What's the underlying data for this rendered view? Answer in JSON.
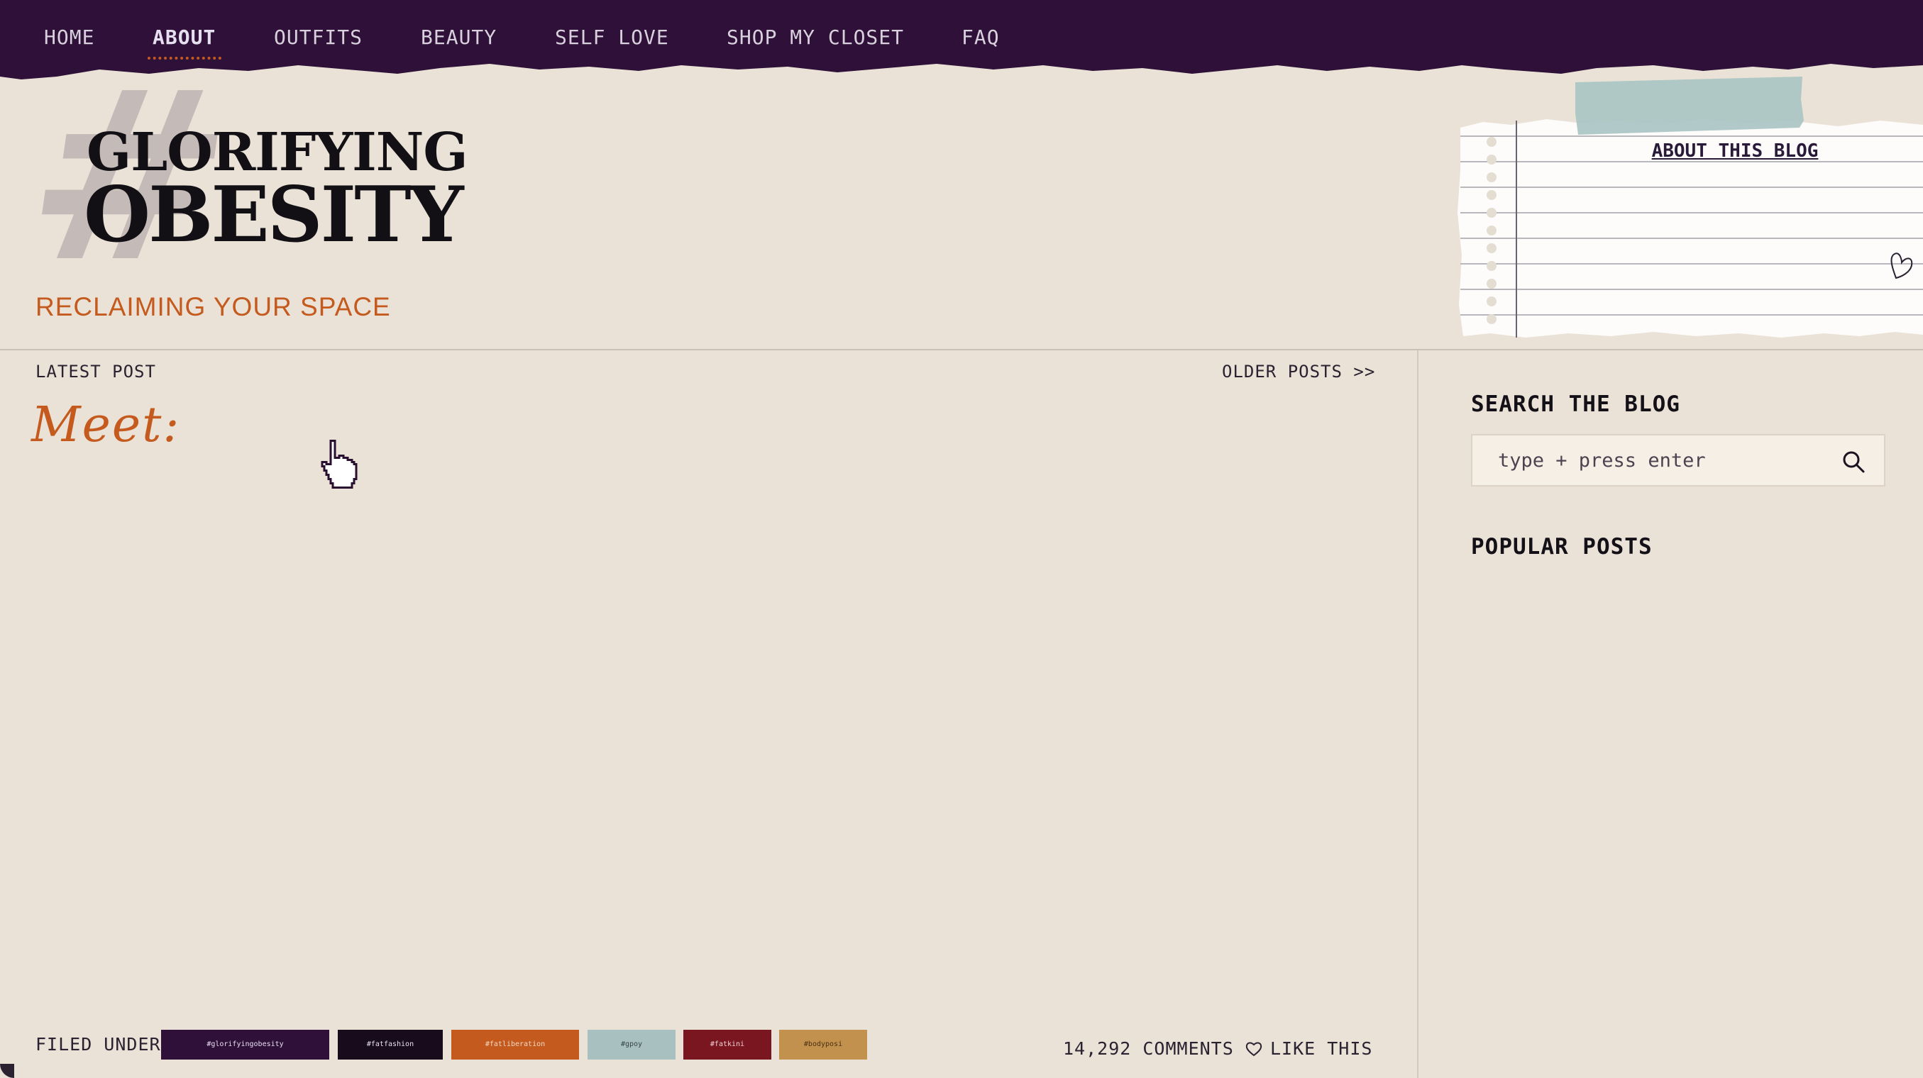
{
  "nav": {
    "items": [
      {
        "label": "HOME"
      },
      {
        "label": "ABOUT"
      },
      {
        "label": "OUTFITS"
      },
      {
        "label": "BEAUTY"
      },
      {
        "label": "SELF LOVE"
      },
      {
        "label": "SHOP MY CLOSET"
      },
      {
        "label": "FAQ"
      }
    ],
    "active_index": 1,
    "background_color": "#2e1038"
  },
  "header": {
    "logo_symbol": "#",
    "logo_line1": "GLORIFYING",
    "logo_line2": "OBESITY",
    "tagline": "RECLAIMING YOUR SPACE",
    "accent_color": "#c55a1e"
  },
  "note": {
    "title": "ABOUT THIS BLOG",
    "tape_color": "#a9c4c3"
  },
  "main": {
    "latest_label": "LATEST POST",
    "older_link": "OLDER POSTS >>",
    "post_heading": "Meet:",
    "filed_under_label": "FILED UNDER:",
    "tags": [
      {
        "label": "#glorifyingobesity",
        "bg": "#2e1038",
        "fg": "#e8dff0"
      },
      {
        "label": "#fatfashion",
        "bg": "#180c1c",
        "fg": "#e8dff0"
      },
      {
        "label": "#fatliberation",
        "bg": "#c55a1e",
        "fg": "#f2d7c4"
      },
      {
        "label": "#gpoy",
        "bg": "#a9c0c1",
        "fg": "#33454a"
      },
      {
        "label": "#fatkini",
        "bg": "#7a1620",
        "fg": "#f0d0d4"
      },
      {
        "label": "#bodyposi",
        "bg": "#c2914e",
        "fg": "#4a3010"
      }
    ],
    "comments": "14,292 COMMENTS",
    "like_label": "LIKE THIS"
  },
  "sidebar": {
    "search_heading": "SEARCH THE BLOG",
    "search_placeholder": "type + press enter",
    "popular_heading": "POPULAR POSTS"
  }
}
